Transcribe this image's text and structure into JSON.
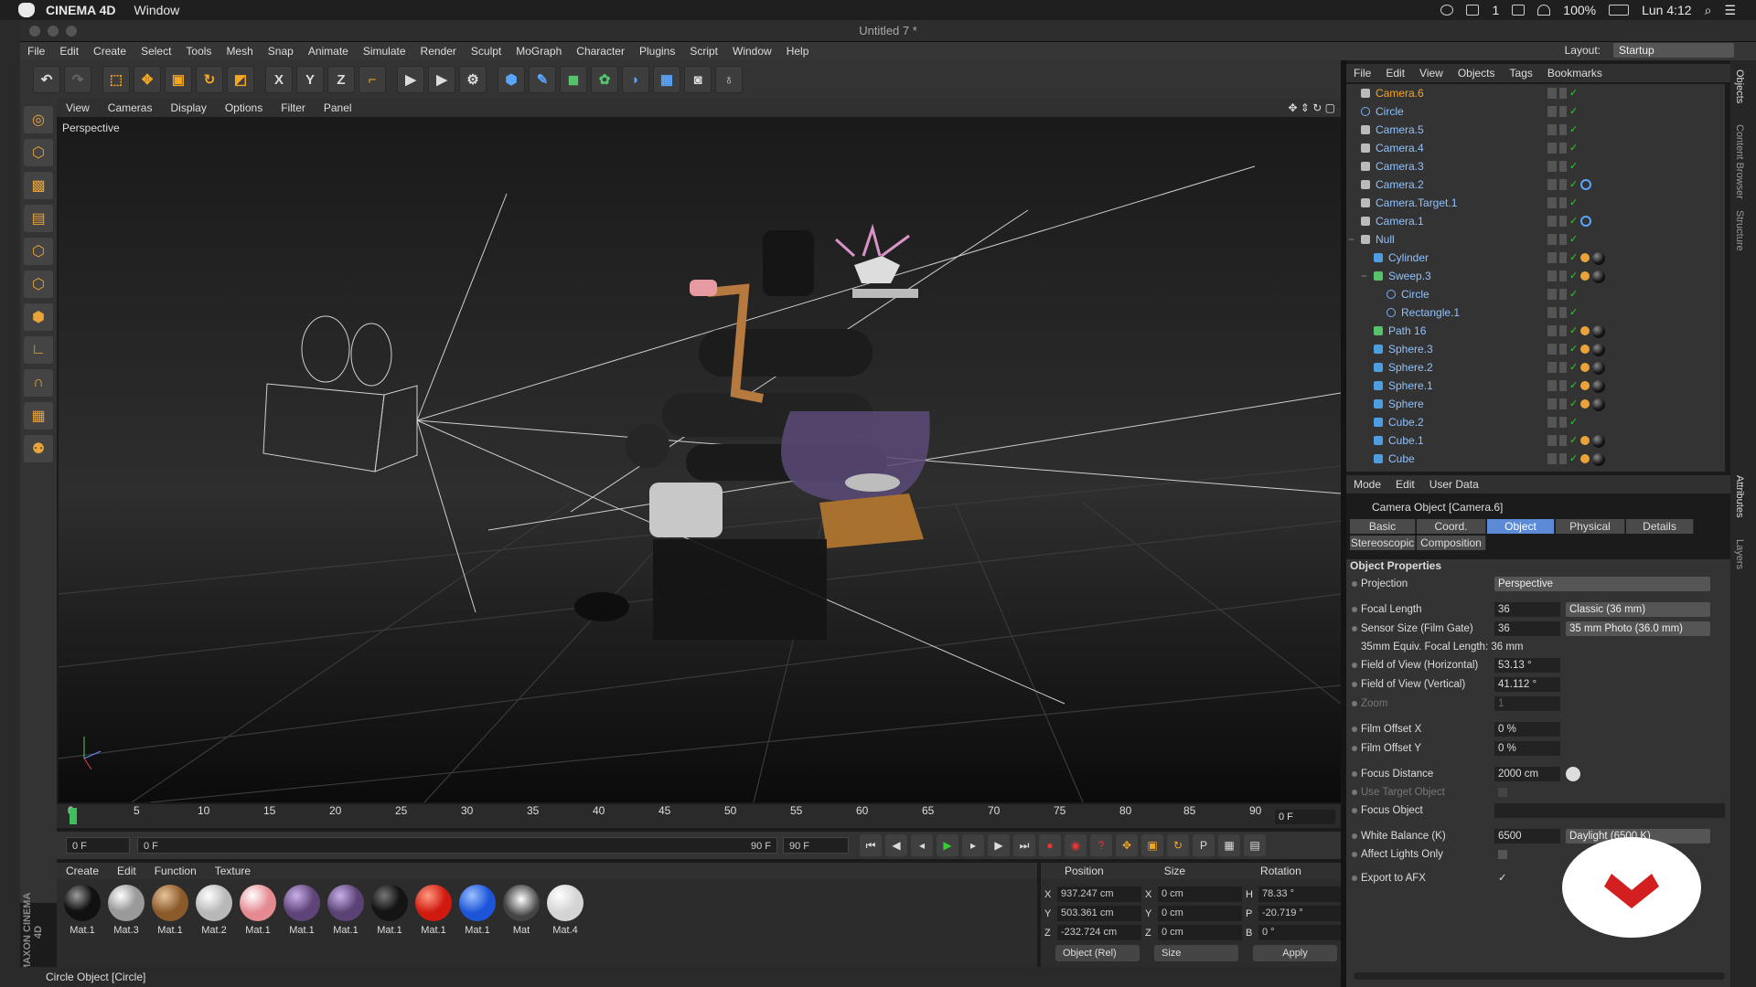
{
  "mac_menubar": {
    "app_name": "CINEMA 4D",
    "menu": "Window",
    "battery": "100%",
    "time": "Lun 4:12",
    "status_numeral": "1"
  },
  "window": {
    "title": "Untitled 7 *"
  },
  "main_menu": [
    "File",
    "Edit",
    "Create",
    "Select",
    "Tools",
    "Mesh",
    "Snap",
    "Animate",
    "Simulate",
    "Render",
    "Sculpt",
    "MoGraph",
    "Character",
    "Plugins",
    "Script",
    "Window",
    "Help"
  ],
  "layout": {
    "label": "Layout:",
    "value": "Startup"
  },
  "toolbar_axes": [
    "X",
    "Y",
    "Z"
  ],
  "viewport": {
    "menu": [
      "View",
      "Cameras",
      "Display",
      "Options",
      "Filter",
      "Panel"
    ],
    "label": "Perspective"
  },
  "timeline": {
    "ticks": [
      "0",
      "5",
      "10",
      "15",
      "20",
      "25",
      "30",
      "35",
      "40",
      "45",
      "50",
      "55",
      "60",
      "65",
      "70",
      "75",
      "80",
      "85",
      "90"
    ],
    "current_frame": "0 F",
    "start_field": "0 F",
    "range_start": "0 F",
    "range_end": "90 F",
    "end_field": "90 F"
  },
  "materials": {
    "menu": [
      "Create",
      "Edit",
      "Function",
      "Texture"
    ],
    "items": [
      {
        "name": "Mat.1",
        "color": "#111111"
      },
      {
        "name": "Mat.3",
        "color": "#9a9a9a"
      },
      {
        "name": "Mat.1",
        "color": "#8a5a2b"
      },
      {
        "name": "Mat.2",
        "color": "#b8b8b8"
      },
      {
        "name": "Mat.1",
        "color": "#e48a90"
      },
      {
        "name": "Mat.1",
        "color": "#5e4478"
      },
      {
        "name": "Mat.1",
        "color": "#5a4275"
      },
      {
        "name": "Mat.1",
        "color": "#141414"
      },
      {
        "name": "Mat.1",
        "color": "#d01a10"
      },
      {
        "name": "Mat.1",
        "color": "#1d55d8"
      },
      {
        "name": "Mat",
        "color": "#cfcfcf"
      },
      {
        "name": "Mat.4",
        "color": "#d4d4d4"
      }
    ],
    "brand": "MAXON CINEMA 4D"
  },
  "coords": {
    "headers": {
      "position": "Position",
      "size": "Size",
      "rotation": "Rotation"
    },
    "rows": [
      {
        "axis": "X",
        "pos": "937.247 cm",
        "size_axis": "X",
        "size": "0 cm",
        "rot_axis": "H",
        "rot": "78.33 °"
      },
      {
        "axis": "Y",
        "pos": "503.361 cm",
        "size_axis": "Y",
        "size": "0 cm",
        "rot_axis": "P",
        "rot": "-20.719 °"
      },
      {
        "axis": "Z",
        "pos": "-232.724 cm",
        "size_axis": "Z",
        "size": "0 cm",
        "rot_axis": "B",
        "rot": "0 °"
      }
    ],
    "mode": "Object (Rel)",
    "size_mode": "Size",
    "apply": "Apply"
  },
  "status": "Circle Object [Circle]",
  "objects_panel": {
    "menu": [
      "File",
      "Edit",
      "View",
      "Objects",
      "Tags",
      "Bookmarks"
    ],
    "items": [
      {
        "name": "Camera.6",
        "indent": 0,
        "kind": "camera",
        "selected": true
      },
      {
        "name": "Circle",
        "indent": 0,
        "kind": "spline"
      },
      {
        "name": "Camera.5",
        "indent": 0,
        "kind": "camera"
      },
      {
        "name": "Camera.4",
        "indent": 0,
        "kind": "camera"
      },
      {
        "name": "Camera.3",
        "indent": 0,
        "kind": "camera"
      },
      {
        "name": "Camera.2",
        "indent": 0,
        "kind": "camera",
        "tag": "target"
      },
      {
        "name": "Camera.Target.1",
        "indent": 0,
        "kind": "null"
      },
      {
        "name": "Camera.1",
        "indent": 0,
        "kind": "camera",
        "tag": "target"
      },
      {
        "name": "Null",
        "indent": 0,
        "kind": "null",
        "expanded": true
      },
      {
        "name": "Cylinder",
        "indent": 1,
        "kind": "prim",
        "tag": "mat"
      },
      {
        "name": "Sweep.3",
        "indent": 1,
        "kind": "gen",
        "tag": "mat",
        "expanded": true
      },
      {
        "name": "Circle",
        "indent": 2,
        "kind": "spline"
      },
      {
        "name": "Rectangle.1",
        "indent": 2,
        "kind": "spline"
      },
      {
        "name": "Path 16",
        "indent": 1,
        "kind": "gen",
        "tag": "mat"
      },
      {
        "name": "Sphere.3",
        "indent": 1,
        "kind": "prim",
        "tag": "mat"
      },
      {
        "name": "Sphere.2",
        "indent": 1,
        "kind": "prim",
        "tag": "mat"
      },
      {
        "name": "Sphere.1",
        "indent": 1,
        "kind": "prim",
        "tag": "mat"
      },
      {
        "name": "Sphere",
        "indent": 1,
        "kind": "prim",
        "tag": "mat"
      },
      {
        "name": "Cube.2",
        "indent": 1,
        "kind": "prim"
      },
      {
        "name": "Cube.1",
        "indent": 1,
        "kind": "prim",
        "tag": "mat"
      },
      {
        "name": "Cube",
        "indent": 1,
        "kind": "prim",
        "tag": "mat"
      }
    ]
  },
  "right_tabs": [
    "Objects",
    "Content Browser",
    "Structure",
    "Attributes",
    "Layers"
  ],
  "attributes": {
    "menu": [
      "Mode",
      "Edit",
      "User Data"
    ],
    "title": "Camera Object [Camera.6]",
    "tabs": [
      "Basic",
      "Coord.",
      "Object",
      "Physical",
      "Details"
    ],
    "tabs2": [
      "Stereoscopic",
      "Composition"
    ],
    "active_tab": "Object",
    "section": "Object Properties",
    "rows": [
      {
        "label": "Projection",
        "value": "",
        "dropdown": "Perspective"
      },
      {
        "label": "Focal Length",
        "value": "36",
        "dropdown": "Classic (36 mm)"
      },
      {
        "label": "Sensor Size (Film Gate)",
        "value": "36",
        "dropdown": "35 mm Photo (36.0 mm)"
      },
      {
        "label": "35mm Equiv. Focal Length: 36 mm",
        "value": ""
      },
      {
        "label": "Field of View (Horizontal)",
        "value": "53.13 °"
      },
      {
        "label": "Field of View (Vertical)",
        "value": "41.112 °"
      },
      {
        "label": "Zoom",
        "value": "1",
        "dim": true
      },
      {
        "label": "Film Offset X",
        "value": "0 %"
      },
      {
        "label": "Film Offset Y",
        "value": "0 %"
      },
      {
        "label": "Focus Distance",
        "value": "2000 cm"
      },
      {
        "label": "Use Target Object",
        "value": "",
        "dim": true
      },
      {
        "label": "Focus Object",
        "value": ""
      },
      {
        "label": "White Balance (K)",
        "value": "6500",
        "dropdown": "Daylight (6500 K)"
      },
      {
        "label": "Affect Lights Only",
        "value": ""
      },
      {
        "label": "Export to AFX",
        "value": "✓"
      }
    ]
  }
}
